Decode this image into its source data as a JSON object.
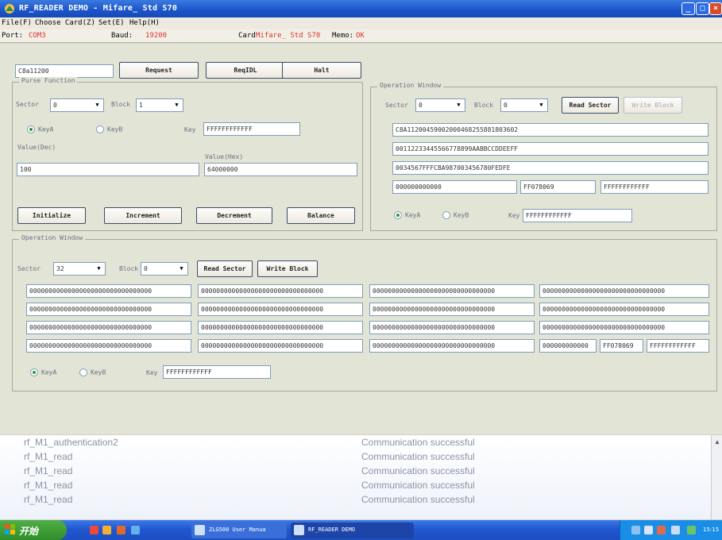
{
  "window": {
    "title": "RF_READER DEMO  -  Mifare_ Std S70"
  },
  "menu": [
    "File(F)",
    "Choose Card(Z)",
    "Set(E)",
    "Help(H)"
  ],
  "status": {
    "port_label": "Port:",
    "port_value": "COM3",
    "baud_label": "Baud:",
    "baud_value": "19200",
    "card_label": "Card",
    "card_value": "Mifare_ Std S70",
    "memo_label": "Memo:",
    "memo_value": "OK"
  },
  "top": {
    "card_id": "C8a11200",
    "request": "Request",
    "reqidl": "ReqIDL",
    "halt": "Halt"
  },
  "purse": {
    "legend": "Purse Function",
    "sector_label": "Sector",
    "sector_value": "0",
    "block_label": "Block",
    "block_value": "1",
    "keya": "KeyA",
    "keyb": "KeyB",
    "key_label": "Key",
    "key_value": "FFFFFFFFFFFF",
    "value_dec_label": "Value(Dec)",
    "value_dec": "100",
    "value_hex_label": "Value(Hex)",
    "value_hex": "64000000",
    "initialize": "Initialize",
    "increment": "Increment",
    "decrement": "Decrement",
    "balance": "Balance"
  },
  "op_right": {
    "legend": "Operation Window",
    "sector_label": "Sector",
    "sector_value": "0",
    "block_label": "Block",
    "block_value": "0",
    "read_sector": "Read Sector",
    "write_block": "Write Block",
    "rows": [
      "C8A11200459002000468255881803602",
      "00112233445566778899AABBCCDDEEFF",
      "0034567FFFCBA987003456780FEDFE"
    ],
    "trailer": [
      "000000000000",
      "FF078069",
      "FFFFFFFFFFFF"
    ],
    "keya": "KeyA",
    "keyb": "KeyB",
    "key_label": "Key",
    "key_value": "FFFFFFFFFFFF"
  },
  "op_bottom": {
    "legend": "Operation Window",
    "sector_label": "Sector",
    "sector_value": "32",
    "block_label": "Block",
    "block_value": "0",
    "read_sector": "Read Sector",
    "write_block": "Write Block",
    "cells": [
      [
        "00000000000000000000000000000000",
        "00000000000000000000000000000000",
        "00000000000000000000000000000000",
        "00000000000000000000000000000000"
      ],
      [
        "00000000000000000000000000000000",
        "00000000000000000000000000000000",
        "00000000000000000000000000000000",
        "00000000000000000000000000000000"
      ],
      [
        "00000000000000000000000000000000",
        "00000000000000000000000000000000",
        "00000000000000000000000000000000",
        "00000000000000000000000000000000"
      ],
      [
        "00000000000000000000000000000000",
        "00000000000000000000000000000000",
        "00000000000000000000000000000000"
      ]
    ],
    "trailer": [
      "000000000000",
      "FF078069",
      "FFFFFFFFFFFF"
    ],
    "keya": "KeyA",
    "keyb": "KeyB",
    "key_label": "Key",
    "key_value": "FFFFFFFFFFFF"
  },
  "log": [
    {
      "fn": "rf_M1_authentication2",
      "msg": "Communication successful"
    },
    {
      "fn": "rf_M1_read",
      "msg": "Communication successful"
    },
    {
      "fn": "rf_M1_read",
      "msg": "Communication successful"
    },
    {
      "fn": "rf_M1_read",
      "msg": "Communication successful"
    },
    {
      "fn": "rf_M1_read",
      "msg": "Communication successful"
    }
  ],
  "taskbar": {
    "start": "开始",
    "task1": "ZLG500 User Manua",
    "task2": "RF_READER DEMO",
    "clock": "15:15"
  }
}
